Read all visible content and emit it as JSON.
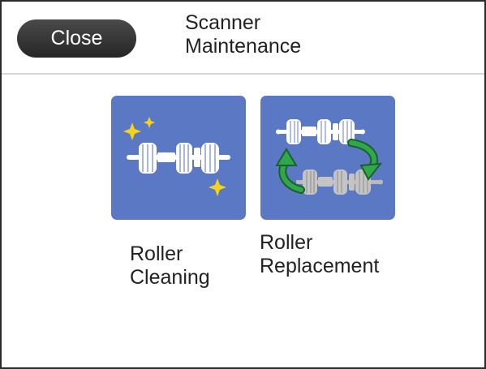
{
  "header": {
    "close_label": "Close",
    "title_line1": "Scanner",
    "title_line2": "Maintenance"
  },
  "tiles": [
    {
      "icon": "roller-cleaning-icon",
      "label_line1": "Roller",
      "label_line2": "Cleaning"
    },
    {
      "icon": "roller-replacement-icon",
      "label_line1": "Roller",
      "label_line2": "Replacement"
    }
  ],
  "colors": {
    "tile_background": "#5b78c4",
    "sparkle": "#f5d21e",
    "arrow": "#2ea84a",
    "close_button": "#333333"
  }
}
